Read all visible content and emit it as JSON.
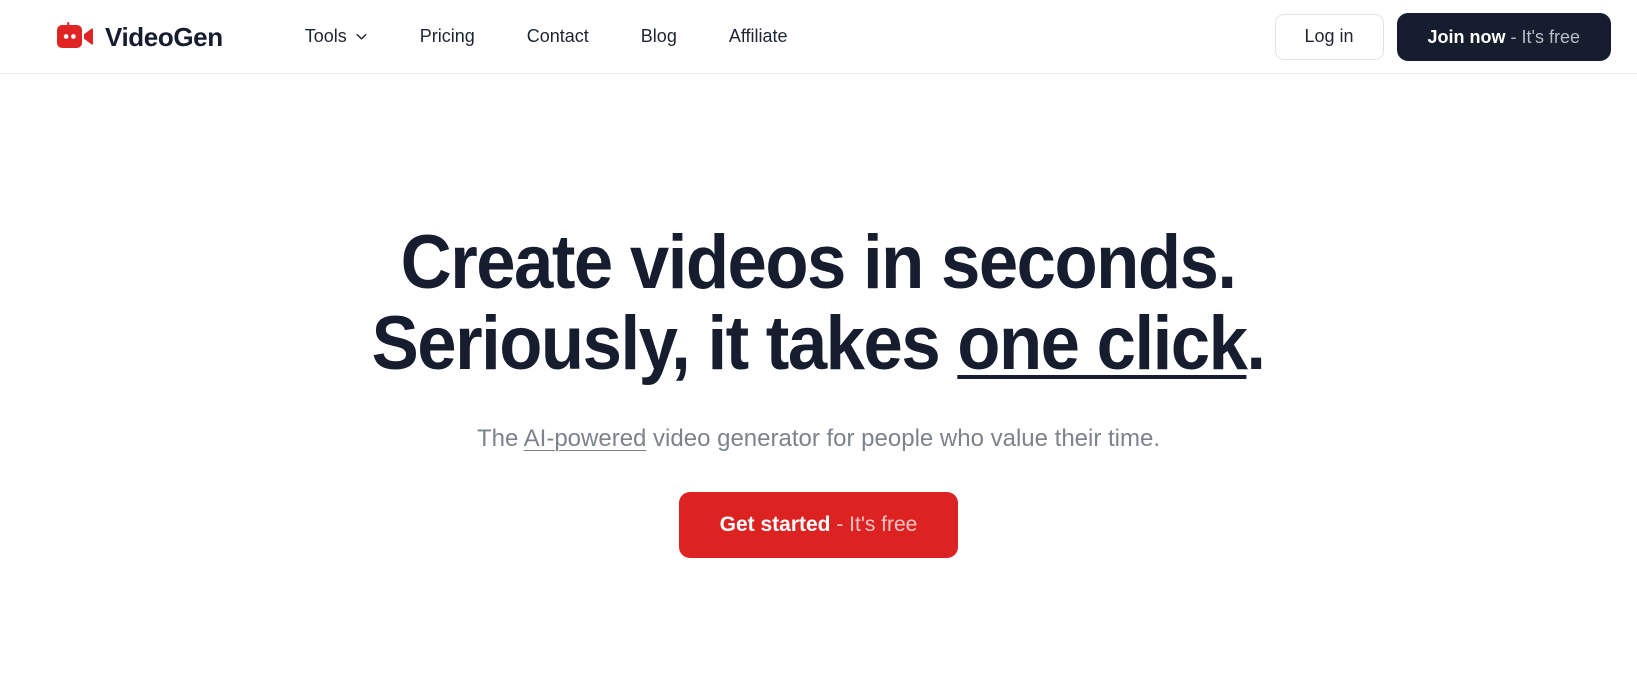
{
  "brand": {
    "name": "VideoGen",
    "logo_icon": "video-camera-robot-icon",
    "logo_color": "#e02424"
  },
  "header": {
    "nav": [
      {
        "label": "Tools",
        "icon": "chevron-down-icon",
        "has_dropdown": true
      },
      {
        "label": "Pricing",
        "has_dropdown": false
      },
      {
        "label": "Contact",
        "has_dropdown": false
      },
      {
        "label": "Blog",
        "has_dropdown": false
      },
      {
        "label": "Affiliate",
        "has_dropdown": false
      }
    ],
    "login_label": "Log in",
    "join": {
      "strong": "Join now",
      "muted": " - It's free"
    },
    "background": "#ffffff",
    "border_color": "#ececf0",
    "dark_button_color": "#161d2e"
  },
  "hero": {
    "headline": {
      "line1": "Create videos in seconds.",
      "line2_pre": "Seriously, it takes ",
      "line2_underlined": "one click",
      "line2_post": "."
    },
    "subtitle": {
      "pre": "The ",
      "underlined": "AI-powered",
      "post": " video generator for people who value their time."
    },
    "cta": {
      "strong": "Get started",
      "muted": " - It's free",
      "color": "#dd2222"
    },
    "text_color": "#161d2e",
    "subtitle_color": "#7c828e"
  }
}
